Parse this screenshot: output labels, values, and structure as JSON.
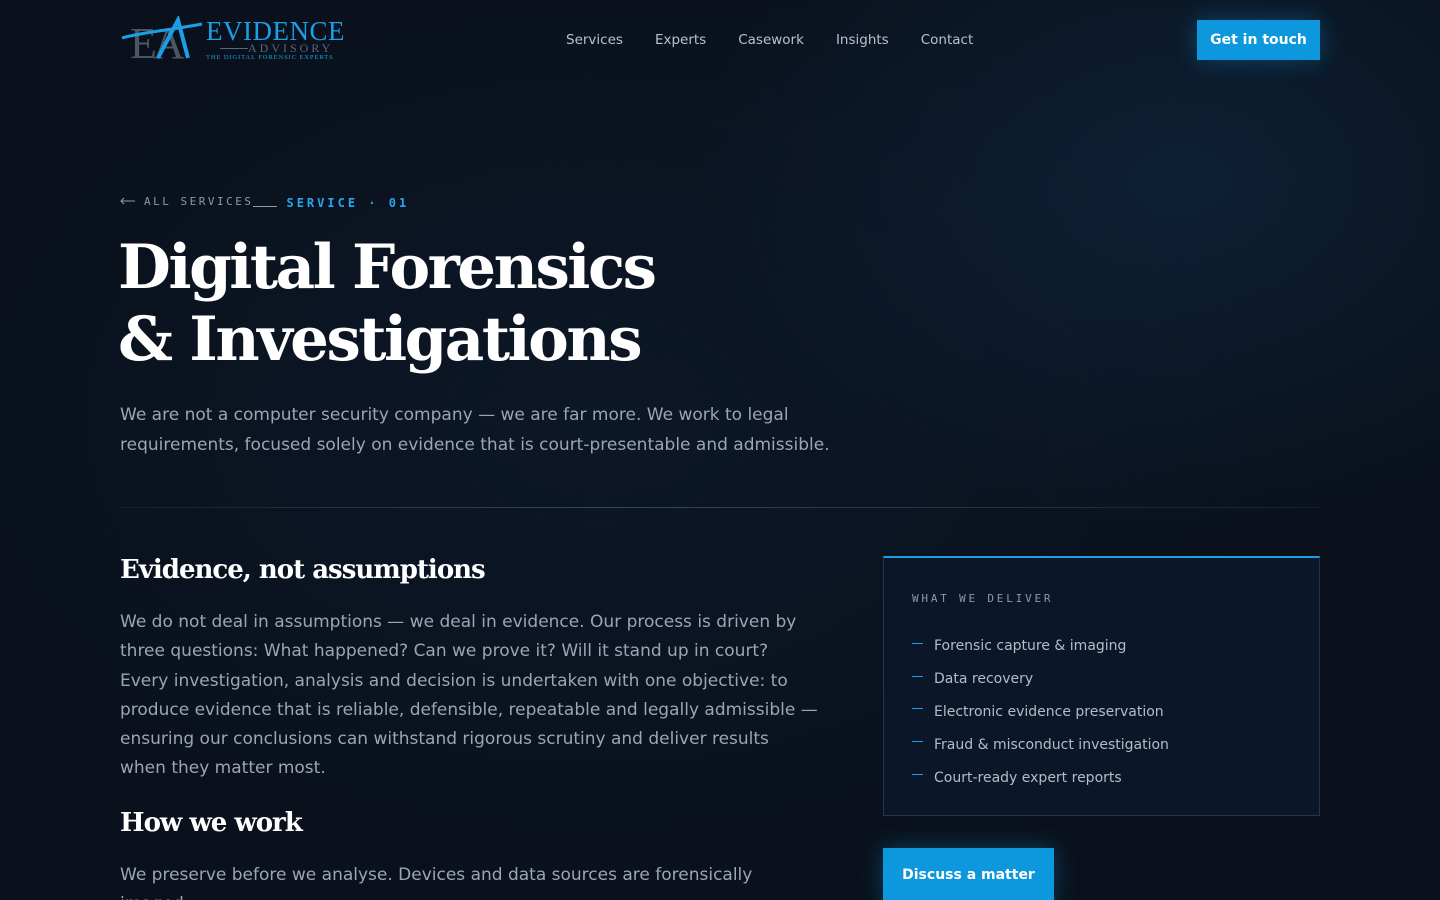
{
  "header": {
    "logo": {
      "monogram": "EA",
      "word": "EVIDENCE",
      "sub": "ADVISORY",
      "tagline": "The Digital Forensic Experts"
    },
    "nav": [
      "Services",
      "Experts",
      "Casework",
      "Insights",
      "Contact"
    ],
    "cta_label": "Get in touch"
  },
  "hero": {
    "back_label": "ALL SERVICES",
    "tag": "SERVICE · 01",
    "title_line1": "Digital Forensics",
    "title_line2": "& Investigations",
    "lead": "We are not a computer security company — we are far more. We work to legal requirements, focused solely on evidence that is court-presentable and admissible."
  },
  "sections": [
    {
      "title": "Evidence, not assumptions",
      "body": "We do not deal in assumptions — we deal in evidence. Our process is driven by three questions: What happened? Can we prove it? Will it stand up in court? Every investigation, analysis and decision is undertaken with one objective: to produce evidence that is reliable, defensible, repeatable and legally admissible — ensuring our conclusions can withstand rigorous scrutiny and deliver results when they matter most."
    },
    {
      "title": "How we work",
      "body": "We preserve before we analyse. Devices and data sources are forensically imaged"
    }
  ],
  "deliver_card": {
    "kicker": "WHAT WE DELIVER",
    "items": [
      "Forensic capture & imaging",
      "Data recovery",
      "Electronic evidence preservation",
      "Fraud & misconduct investigation",
      "Court-ready expert reports"
    ]
  },
  "discuss_cta": "Discuss a matter",
  "colors": {
    "background": "#0a111c",
    "accent": "#0d97dc",
    "card_bg": "#0c1629"
  }
}
